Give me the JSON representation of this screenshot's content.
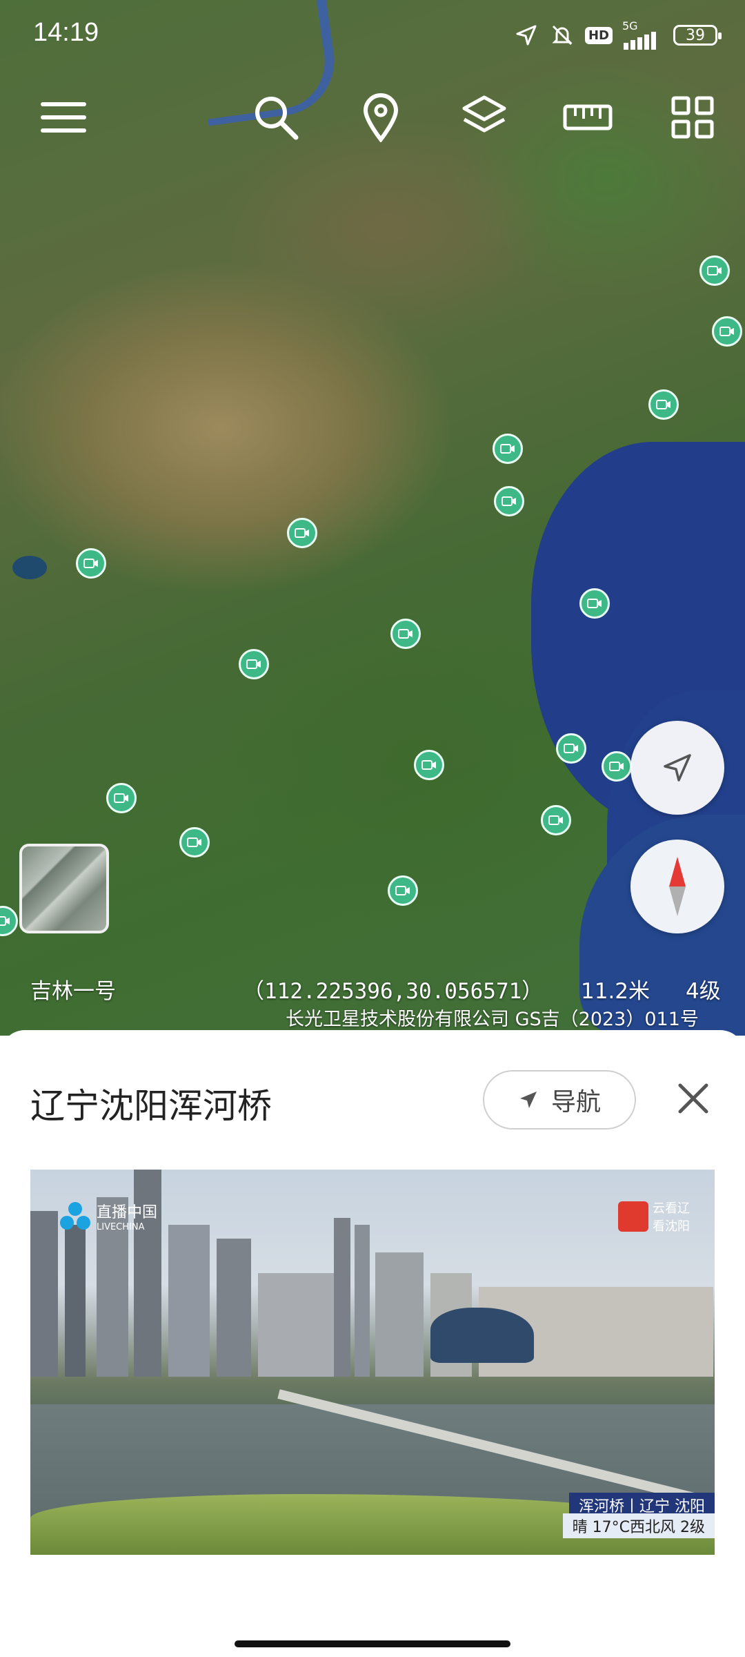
{
  "status_bar": {
    "time": "14:19",
    "network": "5G",
    "hd": "HD",
    "battery": "39",
    "icons": [
      "location-arrow-icon",
      "mute-bell-icon",
      "hd-icon",
      "signal-icon",
      "battery-icon"
    ]
  },
  "toolbar": {
    "icons": [
      "menu-icon",
      "search-icon",
      "pin-icon",
      "layers-icon",
      "ruler-icon",
      "grid-icon"
    ]
  },
  "map": {
    "source_label": "吉林一号",
    "coordinates": "（112.225396,30.056571）",
    "scale": "11.2米",
    "level": "4级",
    "copyright": "长光卫星技术股份有限公司 GS吉（2023）011号",
    "colors": {
      "marker": "#3fb887",
      "sea": "#223d8a"
    }
  },
  "panel": {
    "title": "辽宁沈阳浑河桥",
    "nav_label": "导航",
    "video": {
      "logo_left": "直播中国",
      "logo_left_sub": "LIVECHINA",
      "logo_right_line1": "云看辽",
      "logo_right_line2": "看沈阳",
      "caption_line1": "浑河桥丨辽宁 沈阳",
      "caption_line2": "晴 17°C西北风 2级"
    }
  }
}
